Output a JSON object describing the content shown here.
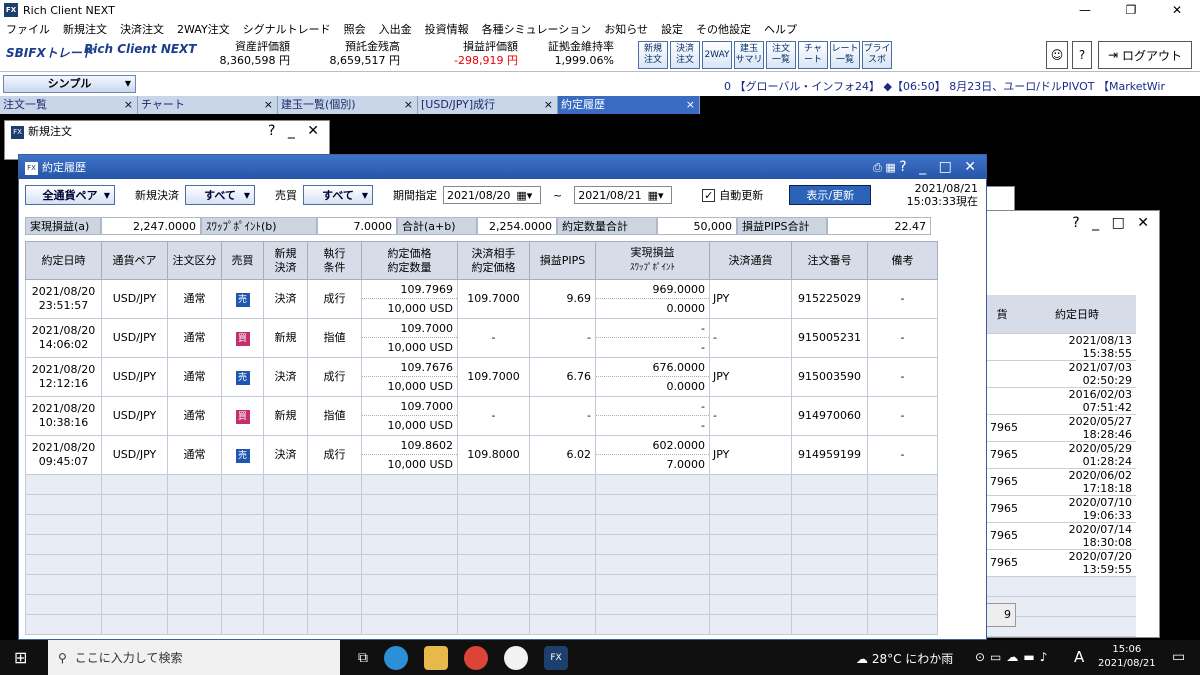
{
  "app": {
    "title": "Rich Client NEXT",
    "fx": "FX"
  },
  "window_controls": {
    "minimize": "—",
    "restore": "❐",
    "close": "✕"
  },
  "menu": [
    "ファイル",
    "新規注文",
    "決済注文",
    "2WAY注文",
    "シグナルトレード",
    "照会",
    "入出金",
    "投資情報",
    "各種シミュレーション",
    "お知らせ",
    "設定",
    "その他設定",
    "ヘルプ"
  ],
  "brand": {
    "logo": "SBIFXトレード",
    "product": "Rich Client NEXT"
  },
  "metrics": [
    {
      "label": "資産評価額",
      "value": "8,360,598 円"
    },
    {
      "label": "預託金残高",
      "value": "8,659,517 円"
    },
    {
      "label": "損益評価額",
      "value": "-298,919 円"
    },
    {
      "label": "証拠金維持率",
      "value": "1,999.06%"
    }
  ],
  "toolbar_buttons": [
    "新規\n注文",
    "決済\n注文",
    "2WAY",
    "建玉\nサマリ",
    "注文\n一覧",
    "チャ\nート",
    "レート\n一覧",
    "プライ\nスボ"
  ],
  "header_right": {
    "help": "?",
    "logout": "ログアウト"
  },
  "layout_selector": "シンプル",
  "ticker": "0 【グローバル・インフォ24】   ◆【06:50】 8月23日、ユーロ/ドルPIVOT 【MarketWir",
  "tabs": [
    {
      "label": "注文一覧",
      "close": "×"
    },
    {
      "label": "チャート",
      "close": "×"
    },
    {
      "label": "建玉一覧(個別)",
      "close": "×"
    },
    {
      "label": "[USD/JPY]成行",
      "close": "×"
    },
    {
      "label": "約定履歴",
      "close": "×"
    }
  ],
  "new_order_window": {
    "title": "新規注文",
    "controls": "? _ ✕"
  },
  "main_window": {
    "title": "約定履歴",
    "controls": "? _ □ ✕",
    "filter": {
      "pair_select": "全通貨ペア",
      "settlement_label": "新規決済",
      "settlement_select": "すべて",
      "trade_label": "売買",
      "trade_select": "すべて",
      "period_label": "期間指定",
      "date_from": "2021/08/20",
      "tilde": "~",
      "date_to": "2021/08/21",
      "auto_update_label": "自動更新",
      "auto_update_check": "✓",
      "display_button": "表示/更新",
      "as_of_date": "2021/08/21",
      "as_of_time": "15:03:33現在"
    },
    "summary": [
      {
        "label": "実現損益(a)",
        "value": "2,247.0000"
      },
      {
        "label": "ｽﾜｯﾌﾟﾎﾟｲﾝﾄ(b)",
        "value": "7.0000"
      },
      {
        "label": "合計(a+b)",
        "value": "2,254.0000"
      },
      {
        "label": "約定数量合計",
        "value": "50,000"
      },
      {
        "label": "損益PIPS合計",
        "value": "22.47"
      }
    ],
    "columns": {
      "date": "約定日時",
      "pair": "通貨ペア",
      "order_type": "注文区分",
      "side": "売買",
      "new_settle_1": "新規",
      "new_settle_2": "決済",
      "exec_1": "執行",
      "exec_2": "条件",
      "price_1": "約定価格",
      "price_2": "約定数量",
      "counter_1": "決済相手",
      "counter_2": "約定価格",
      "pips": "損益PIPS",
      "pl_1": "実現損益",
      "pl_2": "ｽﾜｯﾌﾟﾎﾟｲﾝﾄ",
      "settle_ccy": "決済通貨",
      "order_no": "注文番号",
      "note": "備考"
    },
    "rows": [
      {
        "date": "2021/08/20",
        "time": "23:51:57",
        "pair": "USD/JPY",
        "type": "通常",
        "side": "売",
        "side_kind": "sell",
        "ns": "決済",
        "cond": "成行",
        "price": "109.7969",
        "qty": "10,000 USD",
        "counter": "109.7000",
        "pips": "9.69",
        "pl": "969.0000",
        "swap": "0.0000",
        "ccy": "JPY",
        "order_no": "915225029",
        "note": "-"
      },
      {
        "date": "2021/08/20",
        "time": "14:06:02",
        "pair": "USD/JPY",
        "type": "通常",
        "side": "買",
        "side_kind": "buy",
        "ns": "新規",
        "cond": "指値",
        "price": "109.7000",
        "qty": "10,000 USD",
        "counter": "-",
        "pips": "-",
        "pl": "-",
        "swap": "-",
        "ccy": "-",
        "order_no": "915005231",
        "note": "-"
      },
      {
        "date": "2021/08/20",
        "time": "12:12:16",
        "pair": "USD/JPY",
        "type": "通常",
        "side": "売",
        "side_kind": "sell",
        "ns": "決済",
        "cond": "成行",
        "price": "109.7676",
        "qty": "10,000 USD",
        "counter": "109.7000",
        "pips": "6.76",
        "pl": "676.0000",
        "swap": "0.0000",
        "ccy": "JPY",
        "order_no": "915003590",
        "note": "-"
      },
      {
        "date": "2021/08/20",
        "time": "10:38:16",
        "pair": "USD/JPY",
        "type": "通常",
        "side": "買",
        "side_kind": "buy",
        "ns": "新規",
        "cond": "指値",
        "price": "109.7000",
        "qty": "10,000 USD",
        "counter": "-",
        "pips": "-",
        "pl": "-",
        "swap": "-",
        "ccy": "-",
        "order_no": "914970060",
        "note": "-"
      },
      {
        "date": "2021/08/20",
        "time": "09:45:07",
        "pair": "USD/JPY",
        "type": "通常",
        "side": "売",
        "side_kind": "sell",
        "ns": "決済",
        "cond": "成行",
        "price": "109.8602",
        "qty": "10,000 USD",
        "counter": "109.8000",
        "pips": "6.02",
        "pl": "602.0000",
        "swap": "7.0000",
        "ccy": "JPY",
        "order_no": "914959199",
        "note": "-"
      }
    ]
  },
  "right_window": {
    "controls": "? _ □ ✕",
    "col_partial": "貨",
    "col_date": "約定日時",
    "rows": [
      {
        "p": "",
        "d": "2021/08/13 15:38:55"
      },
      {
        "p": "",
        "d": "2021/07/03 02:50:29"
      },
      {
        "p": "",
        "d": "2016/02/03 07:51:42"
      },
      {
        "p": "7965",
        "d": "2020/05/27 18:28:46"
      },
      {
        "p": "7965",
        "d": "2020/05/29 01:28:24"
      },
      {
        "p": "7965",
        "d": "2020/06/02 17:18:18"
      },
      {
        "p": "7965",
        "d": "2020/07/10 19:06:33"
      },
      {
        "p": "7965",
        "d": "2020/07/14 18:30:08"
      },
      {
        "p": "7965",
        "d": "2020/07/20 13:59:55"
      }
    ],
    "page": "9"
  },
  "taskbar": {
    "search_placeholder": "ここに入力して検索",
    "weather": "28°C にわか雨",
    "ime": "A",
    "time": "15:06",
    "date": "2021/08/21"
  }
}
